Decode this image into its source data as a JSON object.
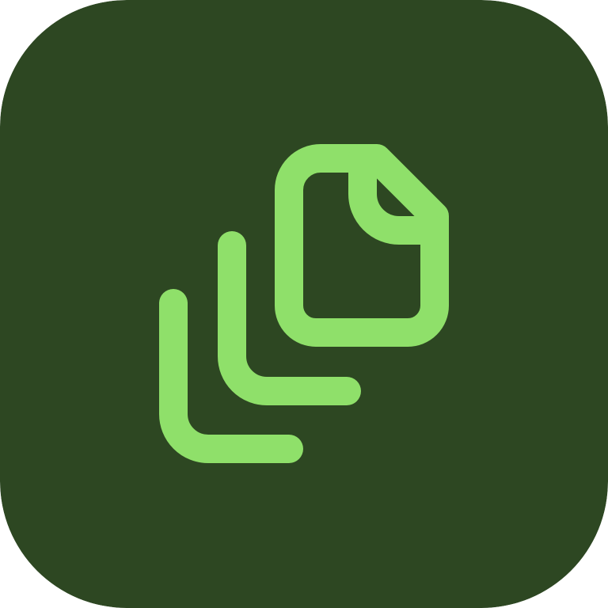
{
  "icon": {
    "name": "stacked-documents-icon",
    "background_color": "#2D4722",
    "stroke_color": "#8FE06A"
  }
}
